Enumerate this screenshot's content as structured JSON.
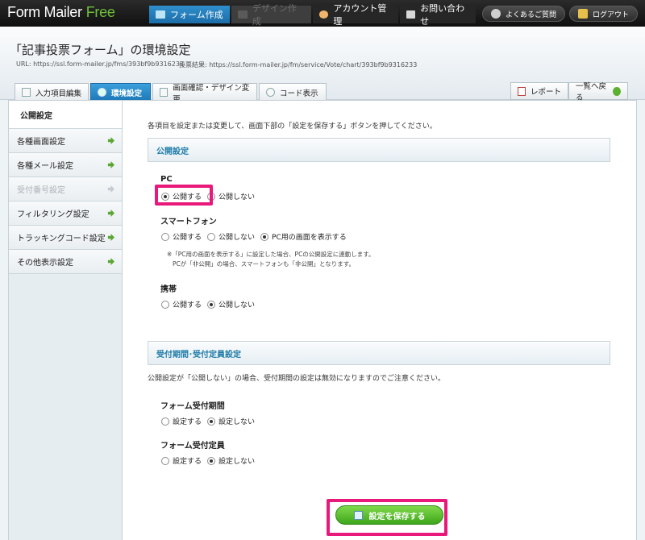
{
  "app": {
    "logo_form": "Form",
    "logo_mailer": "Mailer",
    "logo_free": "Free",
    "nav": [
      "フォーム作成",
      "デザイン作成",
      "アカウント管理",
      "お問い合わせ"
    ],
    "faq": "よくあるご質問",
    "logout": "ログアウト"
  },
  "header": {
    "title": "「記事投票フォーム」の環境設定",
    "url": "URL: https://ssl.form-mailer.jp/fms/393bf9b9316233",
    "result_url": "投票結果: https://ssl.form-mailer.jp/fm/service/Vote/chart/393bf9b9316233",
    "tabs": [
      "入力項目編集",
      "環境設定",
      "画面確認・デザイン変更",
      "コード表示"
    ],
    "report": "レポート",
    "back": "一覧へ戻る"
  },
  "sidebar": {
    "head": "公開設定",
    "items": [
      "各種画面設定",
      "各種メール設定",
      "受付番号設定",
      "フィルタリング設定",
      "トラッキングコード設定",
      "その他表示設定"
    ]
  },
  "main": {
    "intro": "各項目を設定または変更して、画面下部の「設定を保存する」ボタンを押してください。",
    "section1": "公開設定",
    "pc_label": "PC",
    "publish": "公開する",
    "unpublish": "公開しない",
    "sp_label": "スマートフォン",
    "sp_pc_view": "PC用の画面を表示する",
    "note_line1": "※「PC用の画面を表示する」に設定した場合、PCの公開設定に連動します。",
    "note_line2": "PCが「非公開」の場合、スマートフォンも「非公開」となります。",
    "mobile_label": "携帯",
    "section2": "受付期間･受付定員設定",
    "section2_note": "公開設定が「公開しない」の場合、受付期間の設定は無効になりますのでご注意ください。",
    "period_label": "フォーム受付期間",
    "set": "設定する",
    "not_set": "設定しない",
    "capacity_label": "フォーム受付定員",
    "save": "設定を保存する"
  },
  "colors": {
    "accent": "#1e78b8",
    "highlight": "#e8197b",
    "save": "#3fa61d"
  }
}
